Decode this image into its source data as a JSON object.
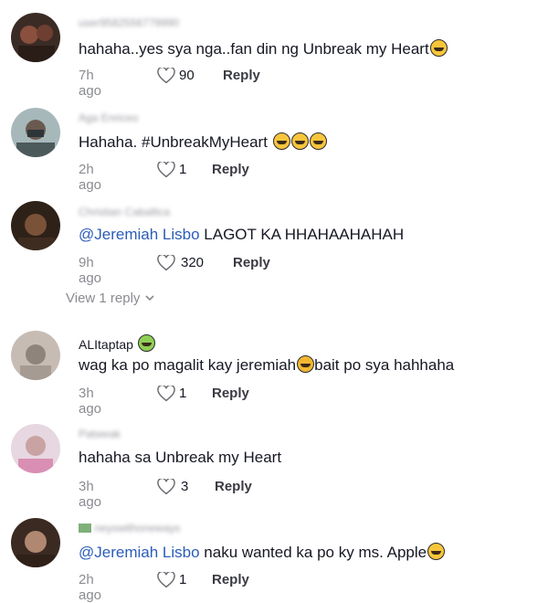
{
  "comments": [
    {
      "username": "user9582556779990",
      "text": "hahaha..yes sya nga..fan din ng Unbreak my Heart",
      "mention": "",
      "emojis": [
        "grinning-squint-emoji"
      ],
      "time": "7h ago",
      "likes": "90",
      "reply": "Reply",
      "avatar_colors": [
        "#3b2b25",
        "#8a4f3d"
      ]
    },
    {
      "username": "Aga Enriceo",
      "text": "Hahaha. #UnbreakMyHeart",
      "mention": "",
      "emojis": [
        "grinning-squint-emoji",
        "grinning-squint-emoji",
        "grinning-squint-emoji"
      ],
      "time": "2h ago",
      "likes": "1",
      "reply": "Reply",
      "avatar_colors": [
        "#8ca0a3",
        "#4c5a5c"
      ]
    },
    {
      "username": "Christian Caballica",
      "text": "LAGOT KA HHAHAAHAHAH",
      "mention": "@Jeremiah Lisbo",
      "emojis": [],
      "time": "9h ago",
      "likes": "320",
      "reply": "Reply",
      "avatar_colors": [
        "#2e2118",
        "#7a5238"
      ]
    },
    {
      "username": "ALItaptap",
      "text": "wag ka po magalit kay jeremiah",
      "text_after": "bait po sya hahhaha",
      "mention": "",
      "emojis": [
        "fear-emoji"
      ],
      "time": "3h ago",
      "likes": "1",
      "reply": "Reply",
      "avatar_colors": [
        "#b8aea6",
        "#8e847c"
      ]
    },
    {
      "username": "Patweak",
      "text": "hahaha sa Unbreak my Heart",
      "mention": "",
      "emojis": [],
      "time": "3h ago",
      "likes": "3",
      "reply": "Reply",
      "avatar_colors": [
        "#d9c5d1",
        "#c28aa4"
      ]
    },
    {
      "username": "neyswithoneways",
      "text": "naku wanted ka po ky ms. Apple",
      "mention": "@Jeremiah Lisbo",
      "emojis": [
        "rolling-laughing-emoji"
      ],
      "time": "2h ago",
      "likes": "1",
      "reply": "Reply",
      "avatar_colors": [
        "#3a2a22",
        "#b08770"
      ]
    }
  ],
  "view_reply": "View 1 reply",
  "colors": {
    "mention": "#2b5db9",
    "meta": "#8a8b91",
    "text": "#161823"
  }
}
